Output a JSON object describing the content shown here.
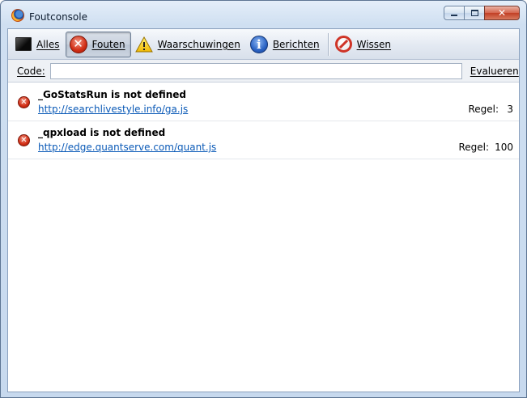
{
  "window": {
    "title": "Foutconsole"
  },
  "toolbar": {
    "items": [
      {
        "label": "Alles",
        "icon": "all-messages-icon"
      },
      {
        "label": "Fouten",
        "icon": "error-icon",
        "active": true
      },
      {
        "label": "Waarschuwingen",
        "icon": "warning-icon"
      },
      {
        "label": "Berichten",
        "icon": "info-icon"
      },
      {
        "label": "Wissen",
        "icon": "clear-icon"
      }
    ]
  },
  "codebar": {
    "label": "Code:",
    "value": "",
    "evaluate_label": "Evalueren"
  },
  "messages": [
    {
      "text": "_GoStatsRun is not defined",
      "source": "http://searchlivestyle.info/ga.js",
      "line_label": "Regel:",
      "line": "3"
    },
    {
      "text": "_qpxload is not defined",
      "source": "http://edge.quantserve.com/quant.js",
      "line_label": "Regel:",
      "line": "100"
    }
  ],
  "colors": {
    "error": "#d12d14",
    "link": "#0b5ab7",
    "accent": "#2a63c4"
  }
}
